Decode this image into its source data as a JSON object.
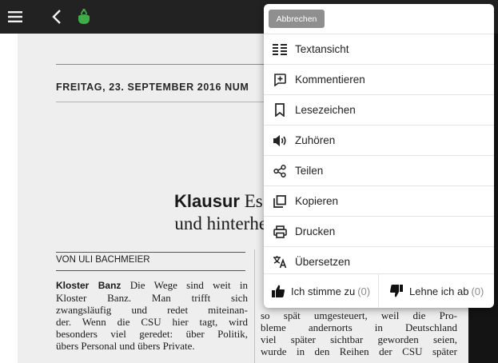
{
  "newspaper": {
    "dateline": "FREITAG, 23. SEPTEMBER 2016 NUM",
    "headline_kicker": "Klausur",
    "headline_line1_rest": " Es rumpelt",
    "headline_line2": "und hinterher ist vor",
    "author": "VON ULI BACHMEIER",
    "left_lead": "Kloster Banz",
    "left_lines": [
      " Die Wege sind weit in",
      "Kloster Banz. Man trifft sich",
      "zwangsläufig und redet miteinan-",
      "der. Wenn die CSU hier tagt, wird",
      "besonders viel geredet: über Politik,",
      "übers Personal und übers Private."
    ],
    "right_lines": [
      "so spät umgesteuert, weil die Pro-",
      "bleme andernorts in Deutschland",
      "viel später sichtbar geworden seien,",
      "wurde in den Reihen der CSU später"
    ]
  },
  "menu": {
    "cancel_label": "Abbrechen",
    "items": [
      {
        "label": "Textansicht",
        "icon": "text-view-icon"
      },
      {
        "label": "Kommentieren",
        "icon": "comment-icon"
      },
      {
        "label": "Lesezeichen",
        "icon": "bookmark-icon"
      },
      {
        "label": "Zuhören",
        "icon": "speaker-icon"
      },
      {
        "label": "Teilen",
        "icon": "share-icon"
      },
      {
        "label": "Kopieren",
        "icon": "copy-icon"
      },
      {
        "label": "Drucken",
        "icon": "print-icon"
      },
      {
        "label": "Übersetzen",
        "icon": "translate-icon"
      }
    ],
    "agree": {
      "label": "Ich stimme zu",
      "count": "(0)",
      "icon": "thumbs-up-icon"
    },
    "disagree": {
      "label": "Lehne ich ab",
      "count": "(0)",
      "icon": "thumbs-down-icon"
    }
  },
  "topbar": {
    "icons": [
      "menu-icon",
      "back-icon",
      "logo-icon"
    ],
    "right_edge_glyph": "I"
  },
  "colors": {
    "topbar_bg": "#222222",
    "accent_green": "#3fae49",
    "cancel_bg": "#8f8f8f",
    "page_bg": "#eeeeee"
  }
}
